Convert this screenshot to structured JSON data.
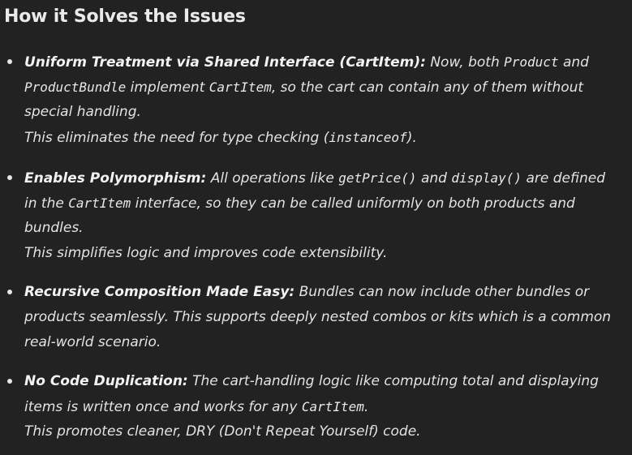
{
  "heading": "How it Solves the Issues",
  "items": [
    {
      "title": "Uniform Treatment via Shared Interface (CartItem):",
      "l0a": " Now, both ",
      "l0code1": "Product",
      "l0b": " and",
      "l1code1": "ProductBundle",
      "l1a": " implement ",
      "l1code2": "CartItem",
      "l1b": ", so the cart can contain any of them without",
      "l2": "special handling.",
      "l3a": "This eliminates the need for type checking (",
      "l3code": "instanceof",
      "l3b": ")."
    },
    {
      "title": "Enables Polymorphism:",
      "l0a": " All operations like ",
      "l0code1": "getPrice()",
      "l0b": " and ",
      "l0code2": "display()",
      "l0c": " are defined",
      "l1a": "in the ",
      "l1code": "CartItem",
      "l1b": " interface, so they can be called uniformly on both products and",
      "l2": "bundles.",
      "l3": "This simplifies logic and improves code extensibility."
    },
    {
      "title": "Recursive Composition Made Easy:",
      "l0a": " Bundles can now include other bundles or",
      "l1": "products seamlessly. This supports deeply nested combos or kits which is a common",
      "l2": "real-world scenario."
    },
    {
      "title": "No Code Duplication:",
      "l0a": " The cart-handling logic like computing total and displaying",
      "l1a": "items is written once and works for any ",
      "l1code": "CartItem",
      "l1b": ".",
      "l2": "This promotes cleaner, DRY (Don't Repeat Yourself) code."
    }
  ]
}
